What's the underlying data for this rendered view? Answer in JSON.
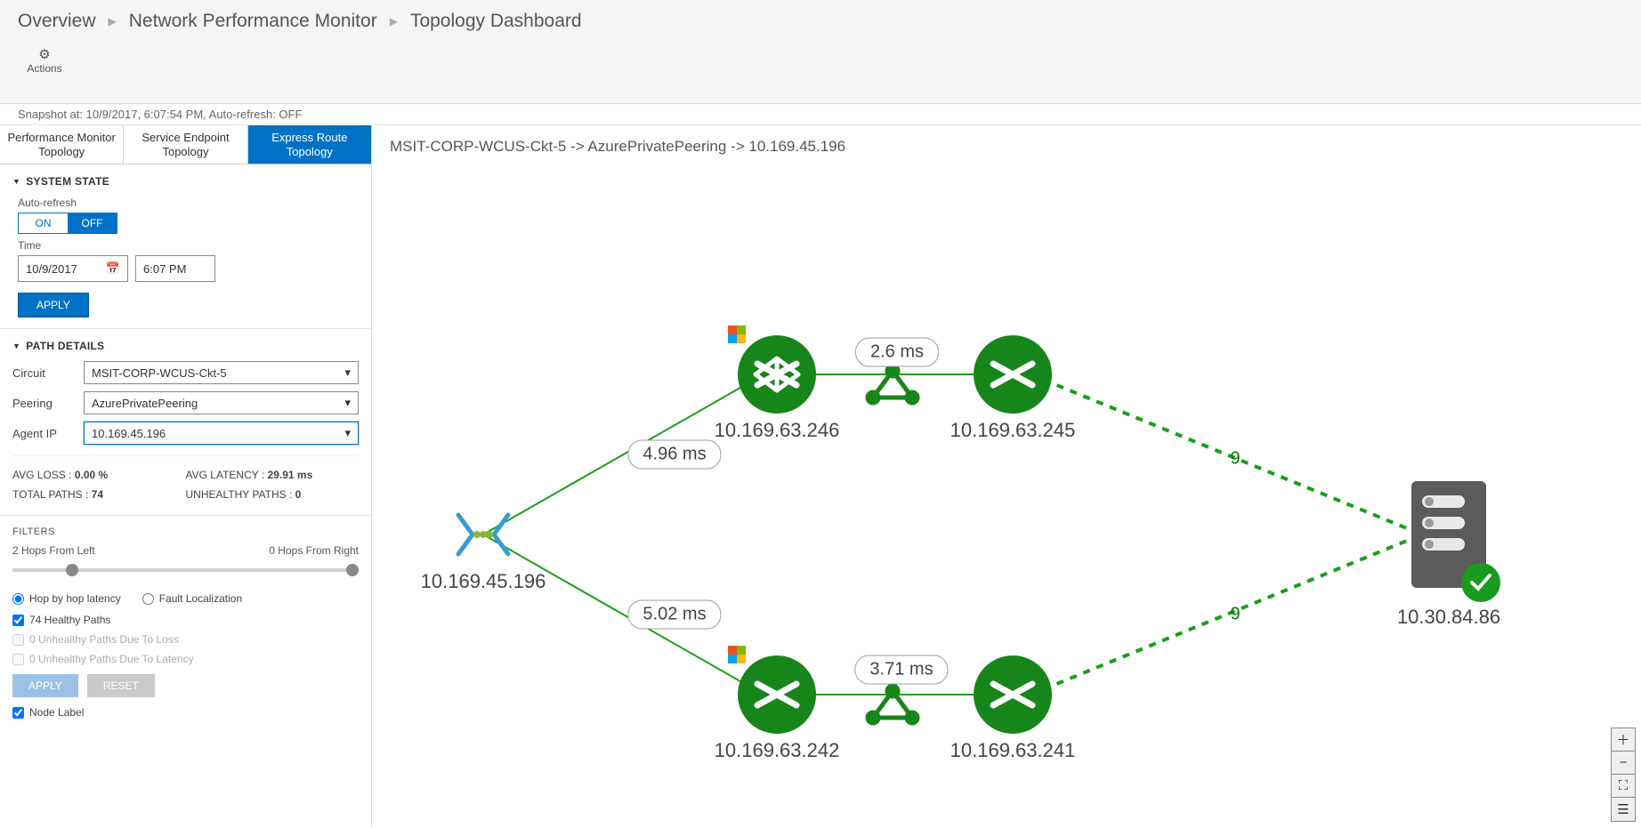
{
  "breadcrumb": [
    "Overview",
    "Network Performance Monitor",
    "Topology Dashboard"
  ],
  "actions_label": "Actions",
  "snapshot": "Snapshot at: 10/9/2017, 6:07:54 PM, Auto-refresh: OFF",
  "tabs": [
    "Performance Monitor Topology",
    "Service Endpoint Topology",
    "Express Route Topology"
  ],
  "active_tab": 2,
  "system_state": {
    "title": "SYSTEM STATE",
    "auto_refresh_label": "Auto-refresh",
    "on": "ON",
    "off": "OFF",
    "time_label": "Time",
    "date": "10/9/2017",
    "time": "6:07 PM",
    "apply": "APPLY"
  },
  "path_details": {
    "title": "PATH DETAILS",
    "circuit_label": "Circuit",
    "circuit": "MSIT-CORP-WCUS-Ckt-5",
    "peering_label": "Peering",
    "peering": "AzurePrivatePeering",
    "agentip_label": "Agent IP",
    "agentip": "10.169.45.196",
    "avg_loss_label": "AVG LOSS :",
    "avg_loss": "0.00 %",
    "avg_latency_label": "AVG LATENCY :",
    "avg_latency": "29.91 ms",
    "total_paths_label": "TOTAL PATHS :",
    "total_paths": "74",
    "unhealthy_label": "UNHEALTHY PATHS :",
    "unhealthy": "0"
  },
  "filters": {
    "title": "FILTERS",
    "left_label": "2 Hops From Left",
    "right_label": "0 Hops From Right",
    "radio_hop": "Hop by hop latency",
    "radio_fault": "Fault Localization",
    "chk_healthy": "74 Healthy Paths",
    "chk_loss": "0 Unhealthy Paths Due To Loss",
    "chk_latency": "0 Unhealthy Paths Due To Latency",
    "apply": "APPLY",
    "reset": "RESET",
    "node_label": "Node Label"
  },
  "topology": {
    "title": "MSIT-CORP-WCUS-Ckt-5 -> AzurePrivatePeering -> 10.169.45.196",
    "nodes": {
      "source": "10.169.45.196",
      "n1": "10.169.63.246",
      "n2": "10.169.63.245",
      "n3": "10.169.63.242",
      "n4": "10.169.63.241",
      "dest": "10.30.84.86"
    },
    "edges": {
      "e_src_n1": "4.96 ms",
      "e_src_n3": "5.02 ms",
      "e_n1_n2": "2.6 ms",
      "e_n3_n4": "3.71 ms",
      "hops_top": "9",
      "hops_bot": "9"
    }
  }
}
